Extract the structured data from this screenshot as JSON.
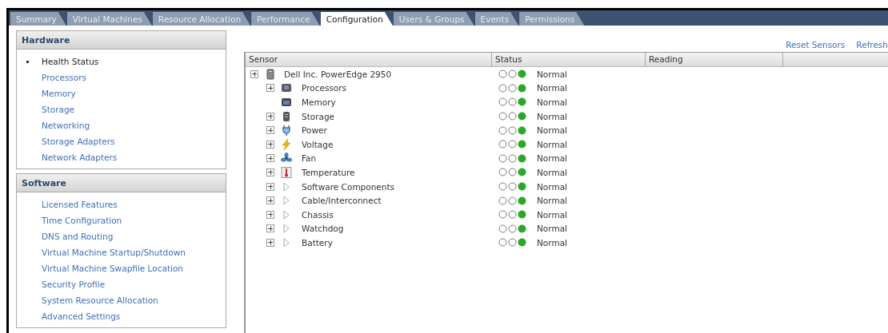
{
  "tabs": [
    {
      "label": "Summary",
      "selected": false
    },
    {
      "label": "Virtual Machines",
      "selected": false
    },
    {
      "label": "Resource Allocation",
      "selected": false
    },
    {
      "label": "Performance",
      "selected": false
    },
    {
      "label": "Configuration",
      "selected": true
    },
    {
      "label": "Users & Groups",
      "selected": false
    },
    {
      "label": "Events",
      "selected": false
    },
    {
      "label": "Permissions",
      "selected": false
    }
  ],
  "sidebar": [
    {
      "title": "Hardware",
      "items": [
        {
          "label": "Health Status",
          "selected": true
        },
        {
          "label": "Processors",
          "selected": false
        },
        {
          "label": "Memory",
          "selected": false
        },
        {
          "label": "Storage",
          "selected": false
        },
        {
          "label": "Networking",
          "selected": false
        },
        {
          "label": "Storage Adapters",
          "selected": false
        },
        {
          "label": "Network Adapters",
          "selected": false
        }
      ]
    },
    {
      "title": "Software",
      "items": [
        {
          "label": "Licensed Features",
          "selected": false
        },
        {
          "label": "Time Configuration",
          "selected": false
        },
        {
          "label": "DNS and Routing",
          "selected": false
        },
        {
          "label": "Virtual Machine Startup/Shutdown",
          "selected": false
        },
        {
          "label": "Virtual Machine Swapfile Location",
          "selected": false
        },
        {
          "label": "Security Profile",
          "selected": false
        },
        {
          "label": "System Resource Allocation",
          "selected": false
        },
        {
          "label": "Advanced Settings",
          "selected": false
        }
      ]
    }
  ],
  "actions": [
    "Reset Sensors",
    "Refresh"
  ],
  "table": {
    "columns": [
      "Sensor",
      "Status",
      "Reading"
    ],
    "rows": [
      {
        "name": "Dell Inc. PowerEdge 2950",
        "kind": "server",
        "expander": true,
        "color": "#2aa82a",
        "status": "Normal",
        "children": [
          {
            "name": "Processors",
            "kind": "processor",
            "expander": true,
            "color": "#2aa82a",
            "status": "Normal"
          },
          {
            "name": "Memory",
            "kind": "memory",
            "expander": false,
            "color": "#2aa82a",
            "status": "Normal"
          },
          {
            "name": "Storage",
            "kind": "storage",
            "expander": true,
            "color": "#2aa82a",
            "status": "Normal"
          },
          {
            "name": "Power",
            "kind": "power",
            "expander": true,
            "color": "#2aa82a",
            "status": "Normal"
          },
          {
            "name": "Voltage",
            "kind": "voltage",
            "expander": true,
            "color": "#2aa82a",
            "status": "Normal"
          },
          {
            "name": "Fan",
            "kind": "fan",
            "expander": true,
            "color": "#2aa82a",
            "status": "Normal"
          },
          {
            "name": "Temperature",
            "kind": "temperature",
            "expander": true,
            "color": "#2aa82a",
            "status": "Normal"
          },
          {
            "name": "Software Components",
            "kind": "other",
            "expander": true,
            "color": "#2aa82a",
            "status": "Normal"
          },
          {
            "name": "Cable/Interconnect",
            "kind": "other",
            "expander": true,
            "color": "#2aa82a",
            "status": "Normal"
          },
          {
            "name": "Chassis",
            "kind": "other",
            "expander": true,
            "color": "#2aa82a",
            "status": "Normal"
          },
          {
            "name": "Watchdog",
            "kind": "other",
            "expander": true,
            "color": "#2aa82a",
            "status": "Normal"
          },
          {
            "name": "Battery",
            "kind": "other",
            "expander": true,
            "color": "#2aa82a",
            "status": "Normal"
          }
        ]
      }
    ]
  }
}
